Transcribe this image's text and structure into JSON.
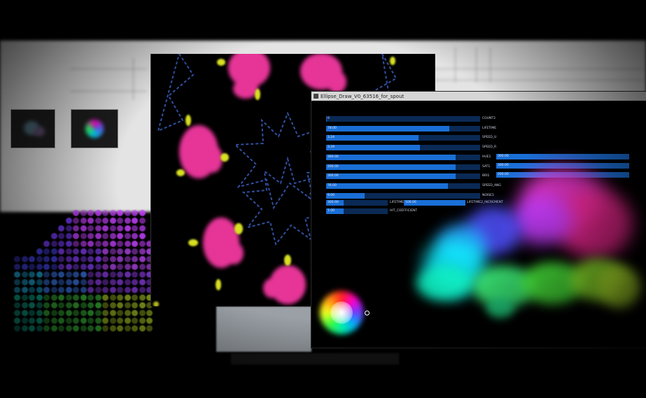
{
  "app_window": {
    "title": "Ellipse_Draw_V0_63516_for_spout"
  },
  "sliders": [
    {
      "value": "0",
      "label": "COUNT2",
      "fraction": 0.0
    },
    {
      "value": "78.00",
      "label": "LIFETIME",
      "fraction": 0.8
    },
    {
      "value": "3.24",
      "label": "SPEED_U",
      "fraction": 0.6
    },
    {
      "value": "3.29",
      "label": "SPEED_R",
      "fraction": 0.61
    },
    {
      "value": "360.00",
      "label": "HUE1",
      "fraction": 0.84
    },
    {
      "value": "200.00",
      "label": "SAT1",
      "fraction": 0.84
    },
    {
      "value": "300.00",
      "label": "BRI1",
      "fraction": 0.84
    },
    {
      "value": "76.00",
      "label": "SPEED_ANG",
      "fraction": 0.79
    },
    {
      "value": "9.00",
      "label": "NOISE1",
      "fraction": 0.25
    }
  ],
  "right_sliders": [
    {
      "value": "300.00",
      "label": ""
    },
    {
      "value": "300.00",
      "label": ""
    },
    {
      "value": "200.00",
      "label": ""
    },
    {
      "value": "0.00",
      "label": ""
    }
  ],
  "lifetime2": {
    "value": "300.00",
    "label": "LIFETIME2",
    "value2": "100.00",
    "label2": "LIFETIME2_INCREMENT"
  },
  "hit_coefficient": {
    "value": "1.00",
    "label": "HIT_COEFFICIENT"
  },
  "colors": {
    "slider_fill": "#1a6fd6",
    "slider_track": "#0a2a55",
    "kaleido_pink": "#ff3ba8",
    "kaleido_yellow": "#d9e021",
    "kaleido_lines": "#2f4fa0"
  }
}
